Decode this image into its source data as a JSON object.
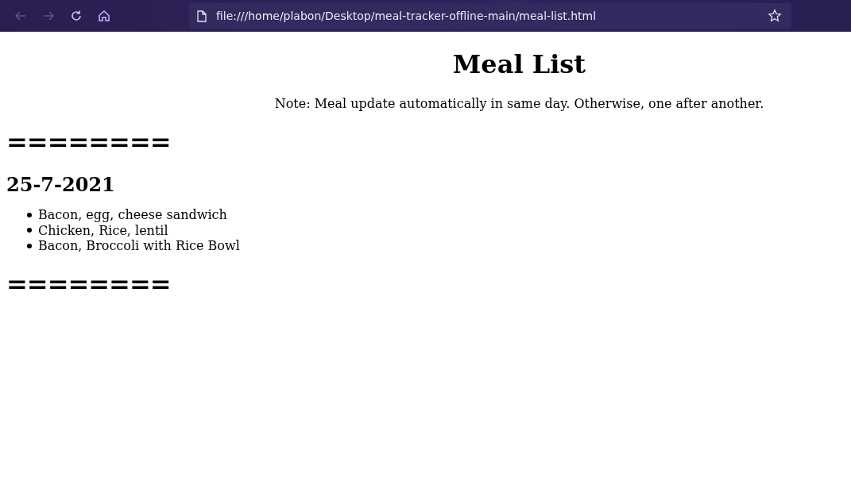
{
  "browser": {
    "nav_buttons": [
      {
        "kind": "back",
        "disabled": true
      },
      {
        "kind": "forward",
        "disabled": true
      },
      {
        "kind": "reload",
        "disabled": false
      },
      {
        "kind": "home",
        "disabled": false
      }
    ],
    "address": "file:///home/plabon/Desktop/meal-tracker-offline-main/meal-list.html"
  },
  "page": {
    "title": "Meal List",
    "note": "Note: Meal update automatically in same day. Otherwise, one after another.",
    "days": [
      {
        "separator": "========",
        "date": "25-7-2021",
        "meals": [
          "Bacon, egg, cheese sandwich",
          "Chicken, Rice, lentil",
          "Bacon, Broccoli with Rice Bowl"
        ]
      }
    ],
    "end_separator": "========"
  }
}
